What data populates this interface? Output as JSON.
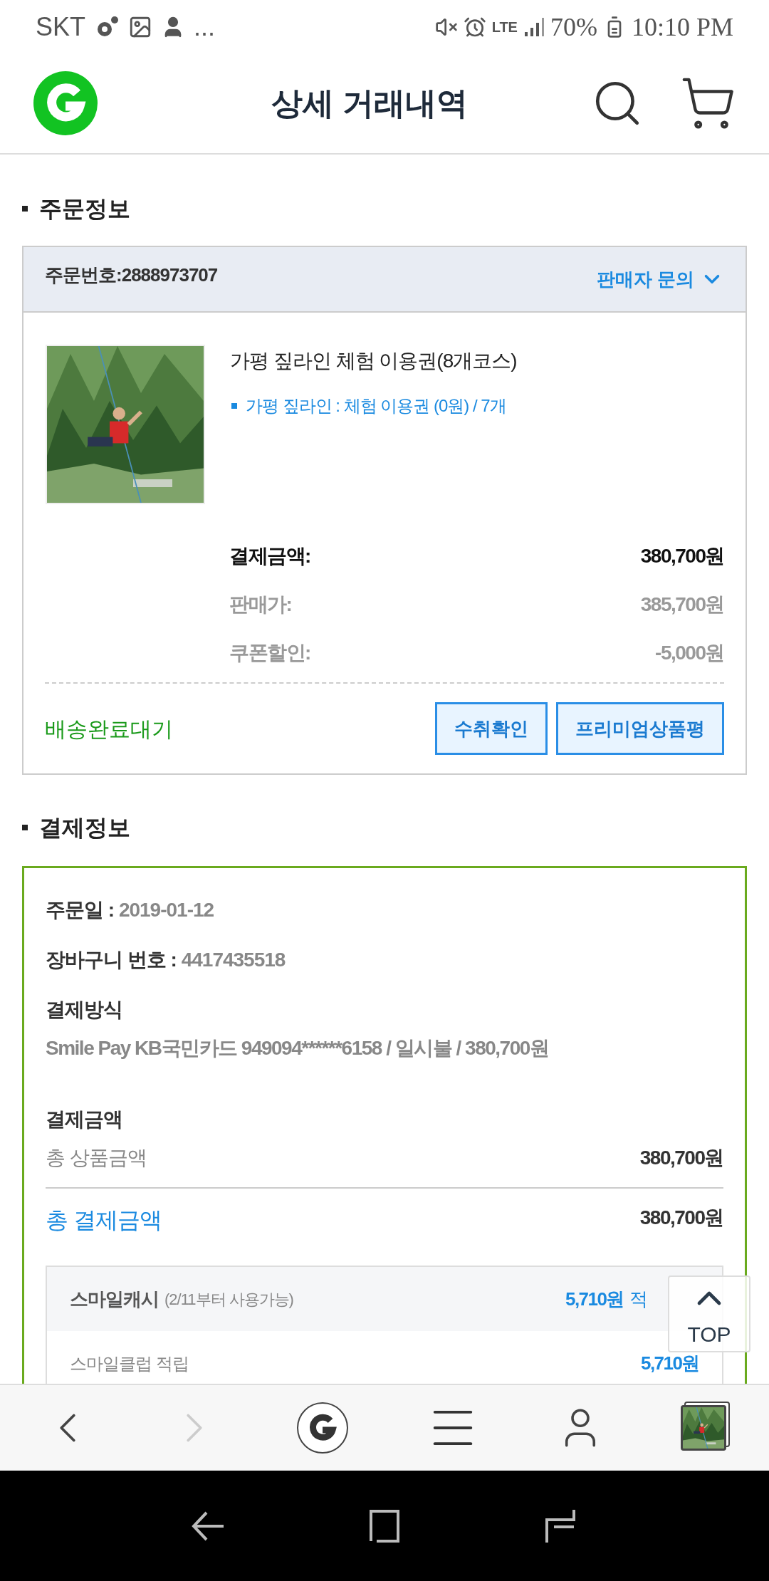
{
  "status_bar": {
    "carrier": "SKT",
    "more": "...",
    "battery": "70%",
    "time": "10:10 PM",
    "network": "LTE"
  },
  "header": {
    "title": "상세 거래내역"
  },
  "order_section": {
    "title": "주문정보",
    "order_number_label": "주문번호:",
    "order_number": "2888973707",
    "seller_inquiry": "판매자 문의",
    "product": {
      "kind": "picture",
      "name": "가평 짚라인 체험 이용권(8개코스)",
      "option": "가평 짚라인 : 체험 이용권 (0원) / 7개"
    },
    "prices": [
      {
        "label": "결제금액:",
        "value": "380,700원",
        "kind": "total"
      },
      {
        "label": "판매가:",
        "value": "385,700원",
        "kind": "sub"
      },
      {
        "label": "쿠폰할인:",
        "value": "-5,000원",
        "kind": "sub"
      }
    ],
    "delivery_status": "배송완료대기",
    "buttons": [
      "수취확인",
      "프리미엄상품평"
    ]
  },
  "payment_section": {
    "title": "결제정보",
    "fields": [
      {
        "label": "주문일 :",
        "value": "2019-01-12"
      },
      {
        "label": "장바구니 번호 :",
        "value": "4417435518"
      }
    ],
    "method_label": "결제방식",
    "method": "Smile Pay KB국민카드 949094******6158 / 일시불 / 380,700원",
    "amount_label": "결제금액",
    "subtotal_label": "총 상품금액",
    "subtotal": "380,700원",
    "total_label": "총 결제금액",
    "total": "380,700원",
    "rewards": [
      {
        "label": "스마일캐시",
        "note": "(2/11부터 사용가능)",
        "value": "5,710원",
        "suffix": "적",
        "kind": "header"
      },
      {
        "label": "스마일클럽 적립",
        "value": "5,710원",
        "kind": "row"
      }
    ]
  },
  "top_button": "TOP"
}
